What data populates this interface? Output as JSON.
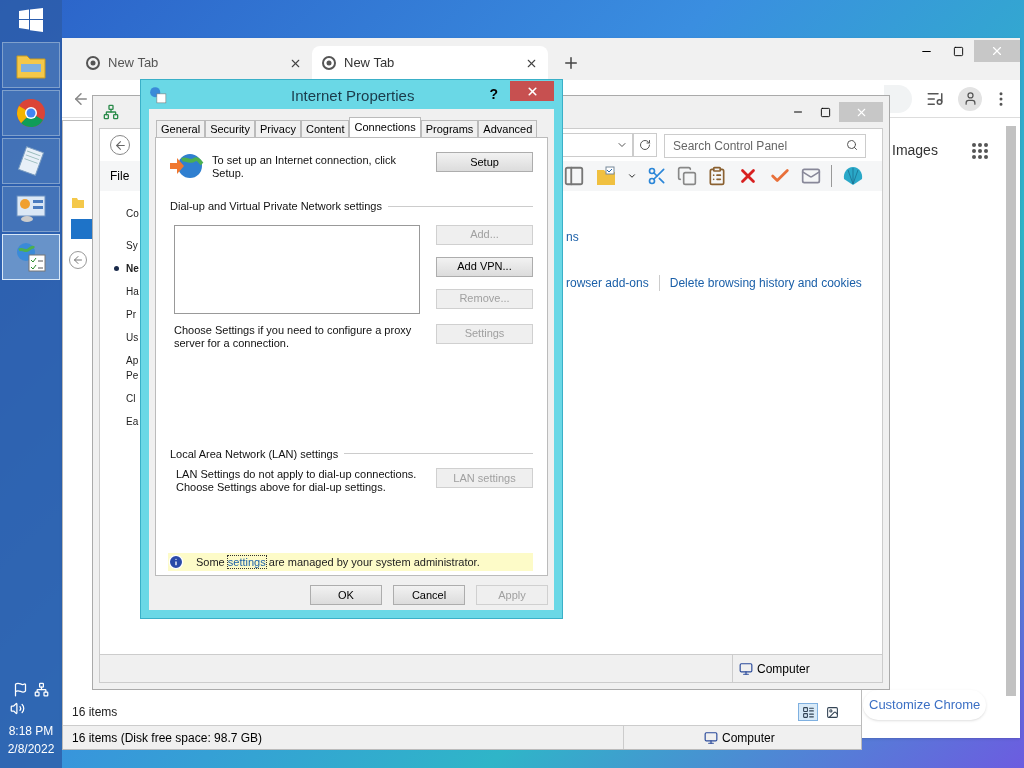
{
  "taskbar": {
    "apps": [
      {
        "kind": "folder",
        "selected": false
      },
      {
        "kind": "browser",
        "selected": false
      },
      {
        "kind": "notepad",
        "selected": false
      },
      {
        "kind": "control-panel",
        "selected": false
      },
      {
        "kind": "internet-options",
        "selected": true
      }
    ],
    "clock": {
      "time": "8:18 PM",
      "date": "2/8/2022"
    }
  },
  "browser": {
    "tabs": [
      {
        "label": "New Tab",
        "selected": false
      },
      {
        "label": "New Tab",
        "selected": true
      }
    ],
    "images_link": "Images",
    "customize_button": "Customize Chrome"
  },
  "explorer_back": {
    "items_count": "16 items",
    "status": "16 items (Disk free space: 98.7 GB)",
    "location": "Computer"
  },
  "explorer_front": {
    "search_placeholder": "Search Control Panel",
    "menu": [
      "File"
    ],
    "sidebar": [
      {
        "label": "Co",
        "selected": false
      },
      {
        "label": "Sy",
        "selected": false
      },
      {
        "label": "Ne",
        "selected": true
      },
      {
        "label": "Ha",
        "selected": false
      },
      {
        "label": "Pr",
        "selected": false
      },
      {
        "label": "Us",
        "selected": false
      },
      {
        "label": "Ap\nPe",
        "selected": false
      },
      {
        "label": "Cl",
        "selected": false
      },
      {
        "label": "Ea",
        "selected": false
      }
    ],
    "links_top": [
      "ns"
    ],
    "links_bottom": [
      "rowser add-ons",
      "Delete browsing history and cookies"
    ],
    "location": "Computer"
  },
  "dialog": {
    "title": "Internet Properties",
    "help": "?",
    "tabs": [
      {
        "label": "General",
        "selected": false
      },
      {
        "label": "Security",
        "selected": false
      },
      {
        "label": "Privacy",
        "selected": false
      },
      {
        "label": "Content",
        "selected": false
      },
      {
        "label": "Connections",
        "selected": true
      },
      {
        "label": "Programs",
        "selected": false
      },
      {
        "label": "Advanced",
        "selected": false
      }
    ],
    "setup_text": "To set up an Internet connection, click Setup.",
    "setup_button": {
      "label": "Setup",
      "disabled": false
    },
    "dialup_heading": "Dial-up and Virtual Private Network settings",
    "dialup_buttons": [
      {
        "label": "Add...",
        "disabled": true
      },
      {
        "label": "Add VPN...",
        "disabled": false
      },
      {
        "label": "Remove...",
        "disabled": true
      }
    ],
    "proxy_text": "Choose Settings if you need to configure a proxy server for a connection.",
    "proxy_button": {
      "label": "Settings",
      "disabled": true
    },
    "lan_heading": "Local Area Network (LAN) settings",
    "lan_lines": [
      "LAN Settings do not apply to dial-up connections.",
      "Choose Settings above for dial-up settings."
    ],
    "lan_button": {
      "label": "LAN settings",
      "disabled": true
    },
    "notice": {
      "before": "Some",
      "link": "settings",
      "after": "are managed by your system administrator."
    },
    "footer_buttons": [
      {
        "label": "OK",
        "disabled": false
      },
      {
        "label": "Cancel",
        "disabled": false
      },
      {
        "label": "Apply",
        "disabled": true
      }
    ]
  }
}
